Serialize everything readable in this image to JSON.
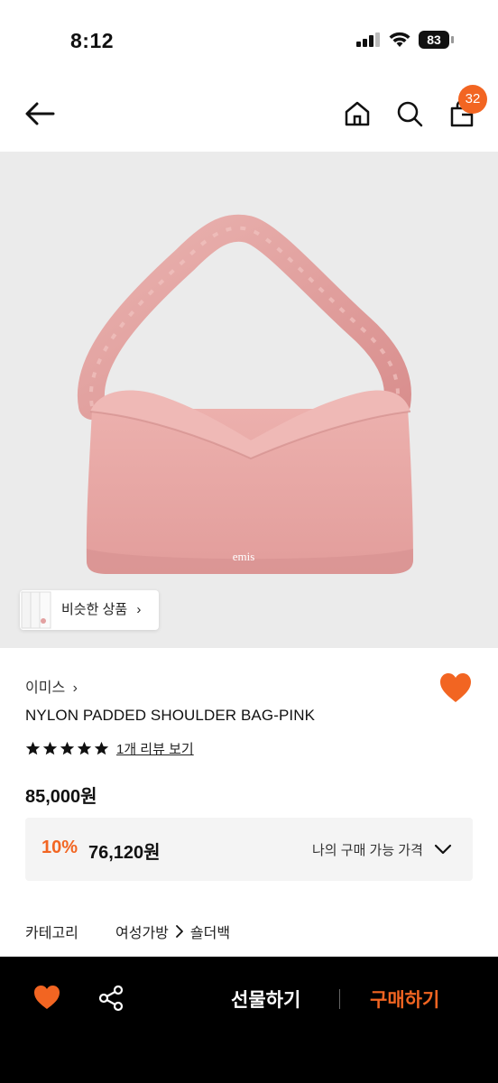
{
  "status_bar": {
    "time": "8:12",
    "battery": "83"
  },
  "nav": {
    "cart_count": "32"
  },
  "product_image": {
    "logo_text": "emis"
  },
  "similar": {
    "label": "비슷한 상품"
  },
  "brand": {
    "name": "이미스"
  },
  "product": {
    "name": "NYLON PADDED SHOULDER BAG-PINK",
    "rating_stars": 5,
    "review_link": "1개 리뷰 보기",
    "price": "85,000원"
  },
  "discount": {
    "rate": "10%",
    "price": "76,120원",
    "my_price_label": "나의 구매 가능 가격"
  },
  "category": {
    "label": "카테고리",
    "path": [
      "여성가방",
      "숄더백"
    ]
  },
  "bottom_bar": {
    "gift_label": "선물하기",
    "buy_label": "구매하기"
  },
  "colors": {
    "accent": "#f26522",
    "bag_pink": "#e9a8a6",
    "image_bg": "#ebebeb"
  }
}
